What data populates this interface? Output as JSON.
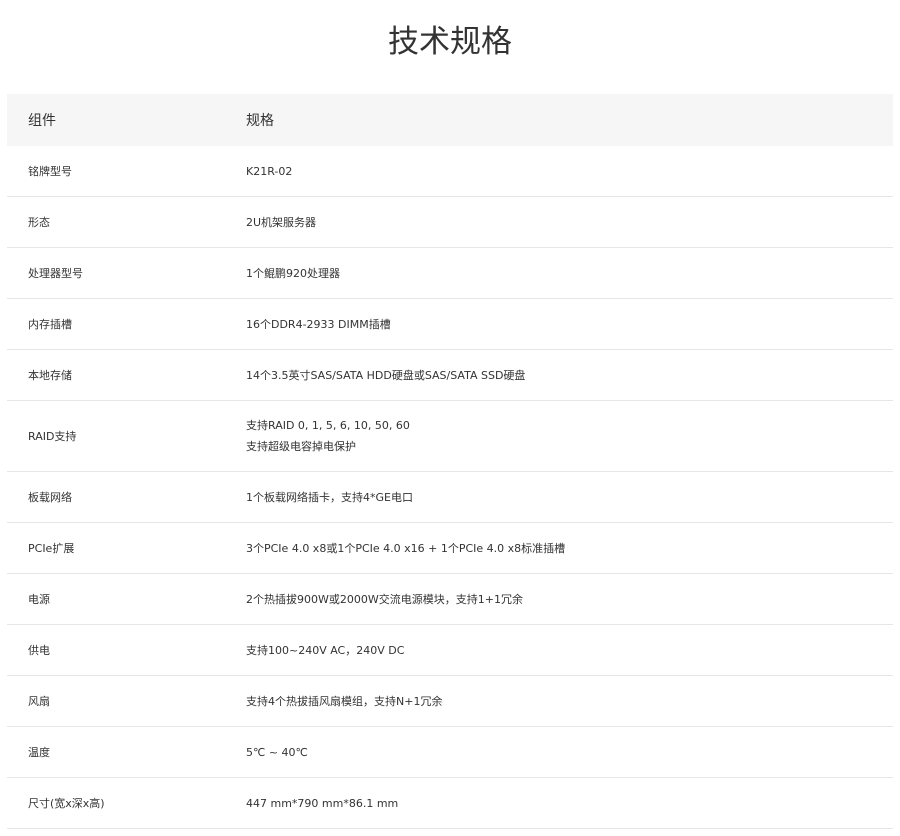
{
  "page": {
    "title": "技术规格"
  },
  "table": {
    "headers": [
      "组件",
      "规格"
    ],
    "rows": [
      {
        "component": "铭牌型号",
        "spec": [
          "K21R-02"
        ]
      },
      {
        "component": "形态",
        "spec": [
          "2U机架服务器"
        ]
      },
      {
        "component": "处理器型号",
        "spec": [
          "1个鲲鹏920处理器"
        ]
      },
      {
        "component": "内存插槽",
        "spec": [
          "16个DDR4-2933 DIMM插槽"
        ]
      },
      {
        "component": "本地存储",
        "spec": [
          "14个3.5英寸SAS/SATA HDD硬盘或SAS/SATA SSD硬盘"
        ]
      },
      {
        "component": "RAID支持",
        "spec": [
          "支持RAID 0, 1, 5, 6, 10, 50, 60",
          "支持超级电容掉电保护"
        ]
      },
      {
        "component": "板载网络",
        "spec": [
          "1个板载网络插卡，支持4*GE电口"
        ]
      },
      {
        "component": "PCIe扩展",
        "spec": [
          "3个PCIe 4.0 x8或1个PCIe 4.0 x16 + 1个PCIe 4.0 x8标准插槽"
        ]
      },
      {
        "component": "电源",
        "spec": [
          "2个热插拔900W或2000W交流电源模块，支持1+1冗余"
        ]
      },
      {
        "component": "供电",
        "spec": [
          "支持100~240V AC，240V DC"
        ]
      },
      {
        "component": "风扇",
        "spec": [
          "支持4个热拔插风扇模组，支持N+1冗余"
        ]
      },
      {
        "component": "温度",
        "spec": [
          "5℃ ~ 40℃"
        ]
      },
      {
        "component": "尺寸(宽x深x高)",
        "spec": [
          "447 mm*790 mm*86.1 mm"
        ]
      }
    ]
  }
}
